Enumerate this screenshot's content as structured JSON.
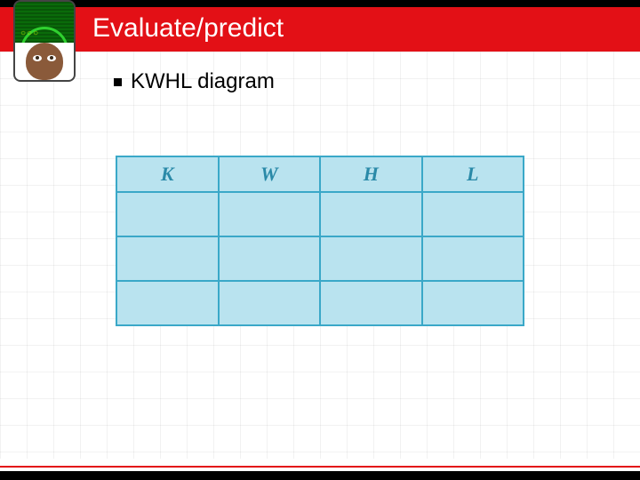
{
  "header": {
    "title": "Evaluate/predict"
  },
  "bullet": {
    "text": "KWHL diagram"
  },
  "table": {
    "headers": [
      "K",
      "W",
      "H",
      "L"
    ],
    "rows": 3,
    "cols": 4
  },
  "avatar": {
    "gears_glyph": "○○○"
  },
  "colors": {
    "accent_red": "#e31016",
    "table_border": "#3aa8c8",
    "table_fill": "#b9e3ef"
  }
}
